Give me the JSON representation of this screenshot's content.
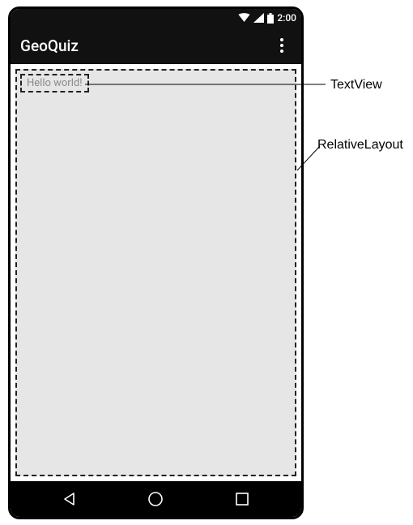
{
  "status": {
    "time": "2:00"
  },
  "actionbar": {
    "title": "GeoQuiz"
  },
  "layout": {
    "textview_text": "Hello world!"
  },
  "annotations": {
    "textview": "TextView",
    "relativelayout": "RelativeLayout"
  }
}
